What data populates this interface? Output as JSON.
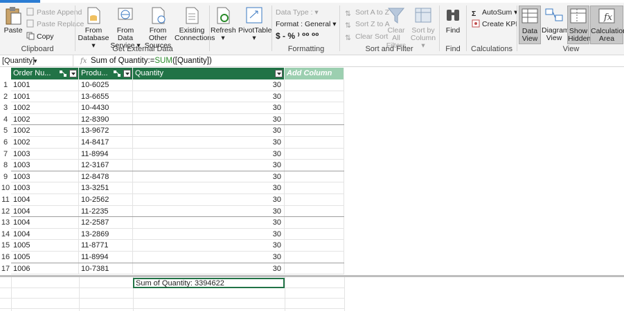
{
  "ribbon": {
    "clipboard": {
      "label": "Clipboard",
      "paste": "Paste",
      "paste_append": "Paste Append",
      "paste_replace": "Paste Replace",
      "copy": "Copy"
    },
    "external": {
      "label": "Get External Data",
      "from_database": "From",
      "from_database2": "Database",
      "from_data_service": "From Data",
      "from_data_service2": "Service",
      "from_other": "From Other",
      "from_other2": "Sources",
      "existing": "Existing",
      "existing2": "Connections"
    },
    "refresh": "Refresh",
    "pivottable": "PivotTable",
    "formatting": {
      "label": "Formatting",
      "data_type": "Data Type :",
      "format": "Format : General",
      "symbols": "$ - % ⁾ ⁰⁰ ⁰⁰"
    },
    "sort": {
      "label": "Sort and Filter",
      "sort_az": "Sort A to Z",
      "sort_za": "Sort Z to A",
      "clear_sort": "Clear Sort",
      "clear_all": "Clear All",
      "clear_all2": "Filters",
      "sort_by": "Sort by",
      "sort_by2": "Column"
    },
    "find": {
      "label": "Find",
      "button": "Find"
    },
    "calc": {
      "label": "Calculations",
      "autosum": "AutoSum",
      "create_kpi": "Create KPI"
    },
    "view": {
      "label": "View",
      "data_view": "Data",
      "data_view2": "View",
      "diagram_view": "Diagram",
      "diagram_view2": "View",
      "show_hidden": "Show",
      "show_hidden2": "Hidden",
      "calc_area": "Calculation",
      "calc_area2": "Area"
    }
  },
  "formula_bar": {
    "name_box": "[Quantity]",
    "fx": "fx",
    "prefix": "Sum of Quantity:=",
    "function": "SUM",
    "args": "([Quantity])"
  },
  "columns": [
    "Order Nu...",
    "Produ...",
    "Quantity",
    "Add Column"
  ],
  "rows": [
    {
      "n": "1",
      "order": "1001",
      "product": "10-6025",
      "qty": "30"
    },
    {
      "n": "2",
      "order": "1001",
      "product": "13-6655",
      "qty": "30"
    },
    {
      "n": "3",
      "order": "1002",
      "product": "10-4430",
      "qty": "30"
    },
    {
      "n": "4",
      "order": "1002",
      "product": "12-8390",
      "qty": "30"
    },
    {
      "n": "5",
      "order": "1002",
      "product": "13-9672",
      "qty": "30"
    },
    {
      "n": "6",
      "order": "1002",
      "product": "14-8417",
      "qty": "30"
    },
    {
      "n": "7",
      "order": "1003",
      "product": "11-8994",
      "qty": "30"
    },
    {
      "n": "8",
      "order": "1003",
      "product": "12-3167",
      "qty": "30"
    },
    {
      "n": "9",
      "order": "1003",
      "product": "12-8478",
      "qty": "30"
    },
    {
      "n": "10",
      "order": "1003",
      "product": "13-3251",
      "qty": "30"
    },
    {
      "n": "11",
      "order": "1004",
      "product": "10-2562",
      "qty": "30"
    },
    {
      "n": "12",
      "order": "1004",
      "product": "11-2235",
      "qty": "30"
    },
    {
      "n": "13",
      "order": "1004",
      "product": "12-2587",
      "qty": "30"
    },
    {
      "n": "14",
      "order": "1004",
      "product": "13-2869",
      "qty": "30"
    },
    {
      "n": "15",
      "order": "1005",
      "product": "11-8771",
      "qty": "30"
    },
    {
      "n": "16",
      "order": "1005",
      "product": "11-8994",
      "qty": "30"
    },
    {
      "n": "17",
      "order": "1006",
      "product": "10-7381",
      "qty": "30"
    }
  ],
  "measure": "Sum of Quantity: 3394622",
  "colors": {
    "header": "#217346",
    "add_column": "#9ccfb0",
    "function": "#2a8a2a"
  }
}
